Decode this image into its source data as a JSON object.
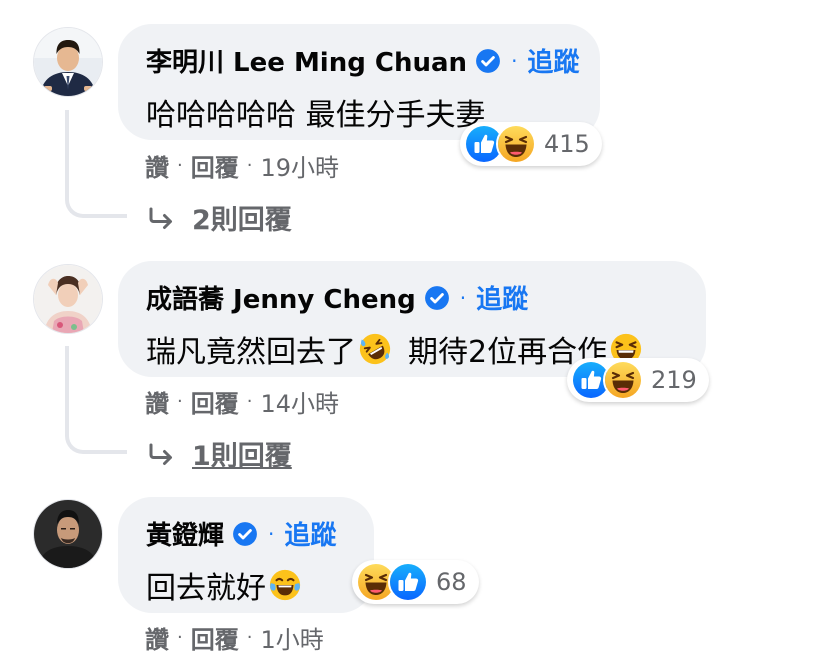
{
  "comments": [
    {
      "author": "李明川 Lee Ming Chuan",
      "dot": "·",
      "follow": "追蹤",
      "text": "哈哈哈哈哈 最佳分手夫妻",
      "reactions": [
        "like",
        "haha"
      ],
      "reaction_count": "415",
      "like_label": "讚",
      "reply_label": "回覆",
      "sep": "·",
      "time": "19小時",
      "replies_label": "2則回覆"
    },
    {
      "author": "成語蕎 Jenny Cheng",
      "dot": "·",
      "follow": "追蹤",
      "text_part1": "瑞凡竟然回去了",
      "text_part2": "期待2位再合作",
      "inline_emojis": [
        "rolling-laughing",
        "grinning-squint"
      ],
      "reactions": [
        "like",
        "haha"
      ],
      "reaction_count": "219",
      "like_label": "讚",
      "reply_label": "回覆",
      "sep": "·",
      "time": "14小時",
      "replies_label": "1則回覆"
    },
    {
      "author": "黃鐙輝",
      "dot": "·",
      "follow": "追蹤",
      "text": "回去就好",
      "inline_emojis": [
        "tears-of-joy"
      ],
      "reactions": [
        "haha",
        "like"
      ],
      "reaction_count": "68",
      "like_label": "讚",
      "reply_label": "回覆",
      "sep": "·",
      "time": "1小時"
    }
  ],
  "colors": {
    "bubble": "#f0f2f5",
    "link": "#1877f2",
    "secondary_text": "#65676b",
    "like_blue": "#1877f2",
    "haha_yellow": "#f7b125"
  },
  "icons": {
    "verified": "verified-badge-icon",
    "reply_arrow": "reply-arrow-icon",
    "like": "like-reaction-icon",
    "haha": "haha-reaction-icon"
  }
}
